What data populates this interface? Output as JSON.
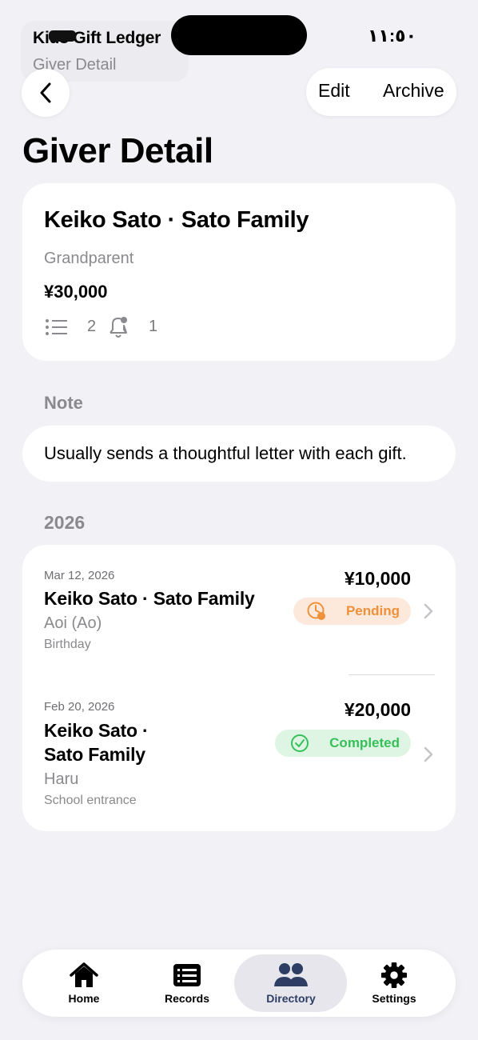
{
  "status_bar": {
    "time": "١١:٥٠"
  },
  "app_header": {
    "title": "Kids Gift Ledger",
    "subtitle": "Giver Detail"
  },
  "nav": {
    "edit_label": "Edit",
    "archive_label": "Archive"
  },
  "page_title": "Giver Detail",
  "giver": {
    "name": "Keiko Sato · Sato Family",
    "relation": "Grandparent",
    "total": "¥30,000",
    "record_count": "2",
    "reminder_count": "1"
  },
  "note": {
    "header": "Note",
    "text": "Usually sends a thoughtful letter with each gift."
  },
  "records": {
    "year": "2026",
    "items": [
      {
        "date": "Mar 12, 2026",
        "giver_line1": "Keiko Sato · Sato Family",
        "giver_line2": "",
        "child": "Aoi (Ao)",
        "occasion": "Birthday",
        "amount": "¥10,000",
        "status": "Pending"
      },
      {
        "date": "Feb 20, 2026",
        "giver_line1": "Keiko Sato ·",
        "giver_line2": "Sato Family",
        "child": "Haru",
        "occasion": "School entrance",
        "amount": "¥20,000",
        "status": "Completed"
      }
    ]
  },
  "tabs": [
    {
      "label": "Home",
      "icon": "house-icon"
    },
    {
      "label": "Records",
      "icon": "list-card-icon"
    },
    {
      "label": "Directory",
      "icon": "people-icon",
      "active": true
    },
    {
      "label": "Settings",
      "icon": "gear-icon"
    }
  ],
  "colors": {
    "pending": "#f0903a",
    "completed": "#37c05a",
    "active_tab": "#2d3d63",
    "background": "#f1f1f6"
  }
}
